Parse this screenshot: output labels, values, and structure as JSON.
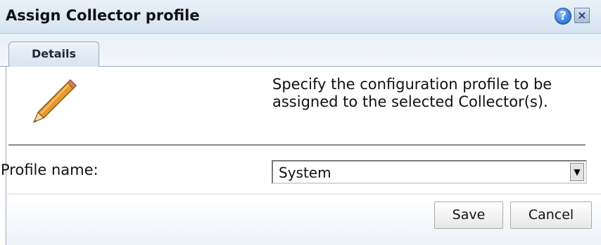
{
  "dialog": {
    "title": "Assign Collector profile",
    "help_symbol": "?",
    "close_symbol": "×"
  },
  "tabs": [
    {
      "label": "Details"
    }
  ],
  "details": {
    "icon": "pencil-icon",
    "description": "Specify the configuration profile to be assigned to the selected Collector(s).",
    "profile_label": "Profile name:",
    "profile_value": "System",
    "dropdown_symbol": "▼"
  },
  "buttons": {
    "save": "Save",
    "cancel": "Cancel"
  }
}
